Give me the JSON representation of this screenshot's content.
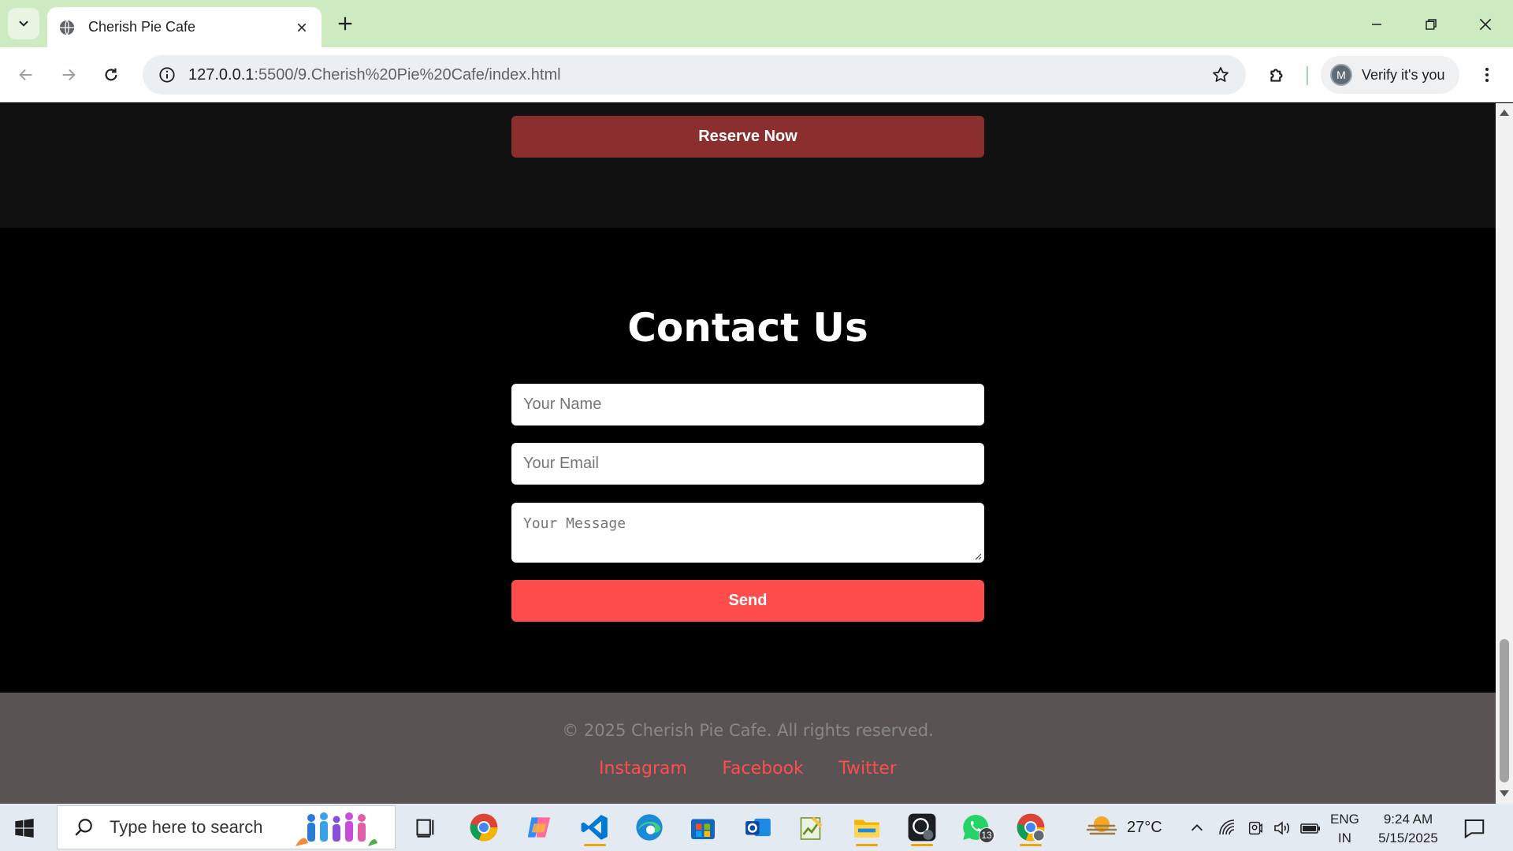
{
  "browser": {
    "tab_title": "Cherish Pie Cafe",
    "url_host": "127.0.0.1",
    "url_path": ":5500/9.Cherish%20Pie%20Cafe/index.html",
    "profile_initial": "M",
    "profile_label": "Verify it's you"
  },
  "page": {
    "reserve_button": "Reserve Now",
    "contact": {
      "heading": "Contact Us",
      "name_placeholder": "Your Name",
      "email_placeholder": "Your Email",
      "message_placeholder": "Your Message",
      "send_button": "Send"
    },
    "footer": {
      "copyright": "© 2025 Cherish Pie Cafe. All rights reserved.",
      "links": [
        "Instagram",
        "Facebook",
        "Twitter"
      ]
    }
  },
  "colors": {
    "reserve_button": "#8b2e2e",
    "send_button": "#ff4c4c",
    "footer_link": "#ff4c4c",
    "footer_bg": "#5a5354",
    "tabstrip_bg": "#cdeac0"
  },
  "taskbar": {
    "search_placeholder": "Type here to search",
    "apps": [
      "task-view-icon",
      "chrome-icon",
      "copilot-icon",
      "vscode-icon",
      "edge-icon",
      "store-icon",
      "outlook-icon",
      "notepad-icon",
      "file-explorer-icon",
      "github-icon",
      "whatsapp-icon",
      "chrome-profile-icon"
    ],
    "whatsapp_badge": "13",
    "weather_temp": "27°C",
    "lang_top": "ENG",
    "lang_bottom": "IN",
    "time": "9:24 AM",
    "date": "5/15/2025"
  }
}
